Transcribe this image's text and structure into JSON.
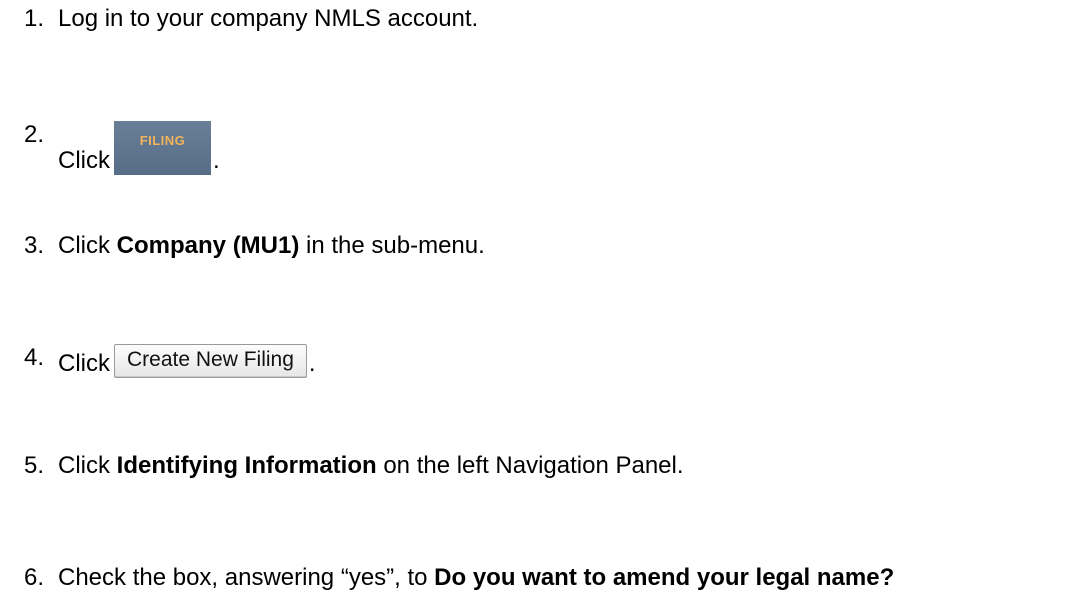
{
  "steps": [
    {
      "num": "1.",
      "text": "Log in to your company NMLS account."
    },
    {
      "num": "2.",
      "prefix": "Click",
      "button": "FILING",
      "suffix": "."
    },
    {
      "num": "3.",
      "prefix": "Click ",
      "bold": "Company (MU1)",
      "suffix": " in the sub-menu."
    },
    {
      "num": "4.",
      "prefix": "Click",
      "button": "Create New Filing",
      "suffix": "."
    },
    {
      "num": "5.",
      "prefix": "Click ",
      "bold": "Identifying Information",
      "suffix": " on the left Navigation Panel."
    },
    {
      "num": "6.",
      "prefix": "Check the box, answering “yes”, to ",
      "bold": "Do you want to amend your legal name?"
    }
  ],
  "colors": {
    "filing_tab_bg": "#5f7590",
    "filing_tab_text": "#f2b35a"
  }
}
